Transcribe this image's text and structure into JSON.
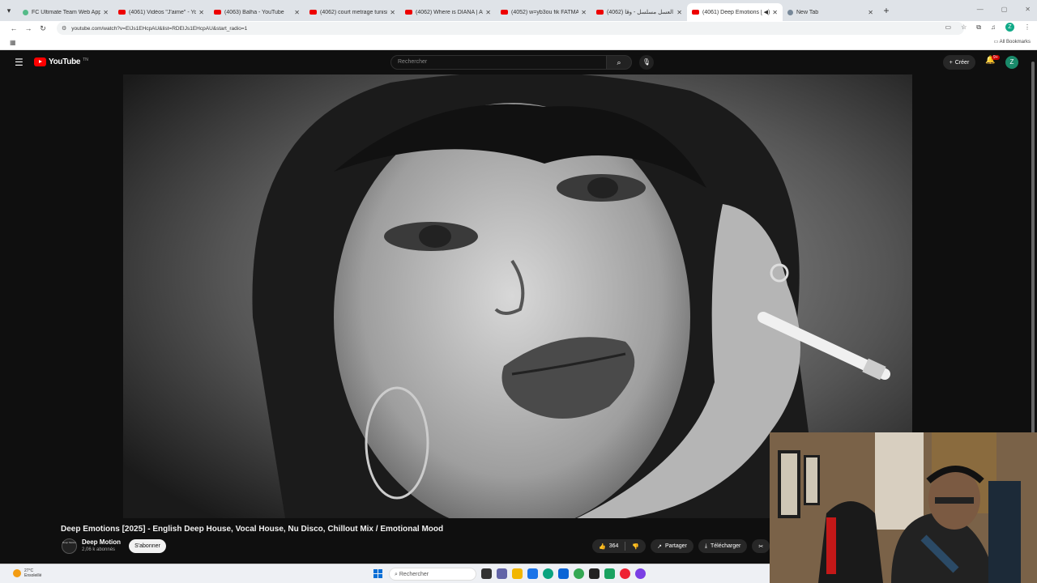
{
  "browser": {
    "tabs": [
      {
        "label": "FC Ultimate Team Web App - E",
        "icon": "fc-icon"
      },
      {
        "label": "(4061) Vidéos \"J'aime\" - YouTu",
        "icon": "youtube-icon"
      },
      {
        "label": "(4063) Balha - YouTube",
        "icon": "youtube-icon"
      },
      {
        "label": "(4062) court metrage tunisien",
        "icon": "youtube-icon"
      },
      {
        "label": "(4062) Where is DIANA | Avant",
        "icon": "youtube-icon"
      },
      {
        "label": "(4052) w=yb3ou fik FATMA BC",
        "icon": "youtube-icon"
      },
      {
        "label": "(4062) شهر العسل مسلسل - وقا",
        "icon": "youtube-icon"
      },
      {
        "label": "(4061) Deep Emotions [20",
        "icon": "youtube-icon",
        "active": true
      },
      {
        "label": "New Tab",
        "icon": "new-tab-icon"
      }
    ],
    "url": "youtube.com/watch?v=EIJs1EHcpAU&list=RDEIJs1EHcpAU&start_radio=1",
    "profile_initial": "Z",
    "all_bookmarks": "All Bookmarks"
  },
  "youtube": {
    "logo_text": "YouTube",
    "logo_suffix": "TN",
    "search_placeholder": "Rechercher",
    "create_label": "Créer",
    "notification_count": "9+",
    "avatar_initial": "Z",
    "video_title": "Deep Emotions [2025] - English Deep House, Vocal House, Nu Disco, Chillout Mix / Emotional Mood",
    "channel_avatar_text": "Deep Motion",
    "channel_name": "Deep Motion",
    "subscribers": "2,06 k abonnés",
    "subscribe_label": "S'abonner",
    "like_count": "364",
    "share_label": "Partager",
    "download_label": "Télécharger"
  },
  "taskbar": {
    "temperature": "27°C",
    "weather_desc": "Ensoleillé",
    "search_placeholder": "Rechercher"
  }
}
